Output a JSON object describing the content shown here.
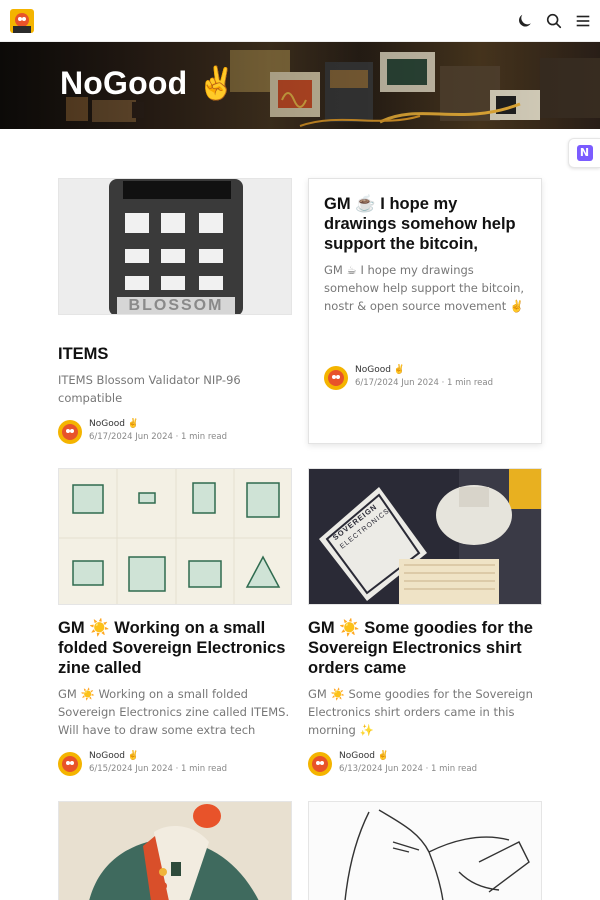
{
  "header": {
    "logo_icon": "nogood-logo-icon",
    "icons": [
      "moon-icon",
      "search-icon",
      "menu-icon"
    ]
  },
  "banner": {
    "title": "NoGood ✌️"
  },
  "nostr_badge": {
    "letter": "N",
    "color": "#7b5cff"
  },
  "posts": [
    {
      "title": "ITEMS",
      "excerpt": "ITEMS Blossom Validator NIP-96 compatible",
      "author": "NoGood ✌️",
      "meta": "6/17/2024 Jun 2024 · 1 min read",
      "thumb_text": "BLOSSOM"
    },
    {
      "title": "GM ☕ I hope my drawings somehow help support the bitcoin,",
      "excerpt": "GM ☕ I hope my drawings somehow help support the bitcoin, nostr & open source movement ✌️",
      "author": "NoGood ✌️",
      "meta": "6/17/2024 Jun 2024 · 1 min read"
    },
    {
      "title": "GM ☀️ Working on a small folded Sovereign Electronics zine called",
      "excerpt": "GM ☀️ Working on a small folded Sovereign Electronics zine called ITEMS. Will have to draw some extra tech befor…",
      "author": "NoGood ✌️",
      "meta": "6/15/2024 Jun 2024 · 1 min read"
    },
    {
      "title": "GM ☀️ Some goodies for the Sovereign Electronics shirt orders came",
      "excerpt": "GM ☀️ Some goodies for the Sovereign Electronics shirt orders came in this morning ✨",
      "author": "NoGood ✌️",
      "meta": "6/13/2024 Jun 2024 · 1 min read",
      "thumb_text_1": "SOVEREIGN",
      "thumb_text_2": "ELECTRONICS"
    }
  ]
}
